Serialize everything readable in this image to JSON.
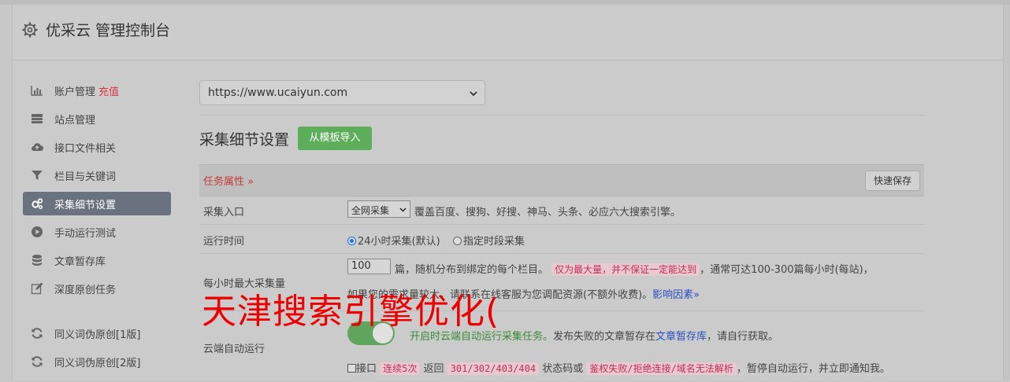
{
  "header": {
    "title": "优采云 管理控制台",
    "icon": "gear-icon"
  },
  "sidebar": {
    "items": [
      {
        "label": "账户管理",
        "badge": "充值",
        "icon": "bar-chart-icon"
      },
      {
        "label": "站点管理",
        "icon": "server-icon"
      },
      {
        "label": "接口文件相关",
        "icon": "cloud-upload-icon"
      },
      {
        "label": "栏目与关键词",
        "icon": "filter-icon"
      },
      {
        "label": "采集细节设置",
        "icon": "gears-icon",
        "active": true
      },
      {
        "label": "手动运行测试",
        "icon": "play-circle-icon"
      },
      {
        "label": "文章暂存库",
        "icon": "database-icon"
      },
      {
        "label": "深度原创任务",
        "icon": "edit-icon"
      },
      {
        "label": "同义词伪原创[1版]",
        "icon": "refresh-icon"
      },
      {
        "label": "同义词伪原创[2版]",
        "icon": "refresh-icon"
      }
    ]
  },
  "site_select": {
    "value": "https://www.ucaiyun.com"
  },
  "section": {
    "title": "采集细节设置",
    "import_button": "从模板导入",
    "task_attr": "任务属性 »",
    "save_button": "快速保存"
  },
  "rows": {
    "entry": {
      "label": "采集入口",
      "select_value": "全网采集",
      "desc": "覆盖百度、搜狗、好搜、神马、头条、必应六大搜索引擎。"
    },
    "runtime": {
      "label": "运行时间",
      "opt1": "24小时采集(默认)",
      "opt2": "指定时段采集"
    },
    "hourly_max": {
      "label": "每小时最大采集量",
      "value": "100",
      "text1": "篇，随机分布到绑定的每个栏目。",
      "pill": "仅为最大量，并不保证一定能达到",
      "text2": "，通常可达100-300篇每小时(每站)，",
      "text3": "如果您的需求量较大，请联系在线客服为您调配资源(不额外收费)。",
      "link": "影响因素»"
    },
    "cloud": {
      "label": "云端自动运行",
      "green_text": "开启时云端自动运行采集任务。",
      "text1": "发布失败的文章暂存在",
      "link": "文章暂存库",
      "text2": "，请自行获取。",
      "cb_label": "接口",
      "pill1": "连续5次",
      "text3": "返回",
      "pill2": "301/302/403/404",
      "text4": "状态码或",
      "pill3": "鉴权失败/拒绝连接/域名无法解析",
      "text5": "，暂停自动运行，并立即通知我。"
    }
  },
  "watermark": "天津搜索引擎优化("
}
